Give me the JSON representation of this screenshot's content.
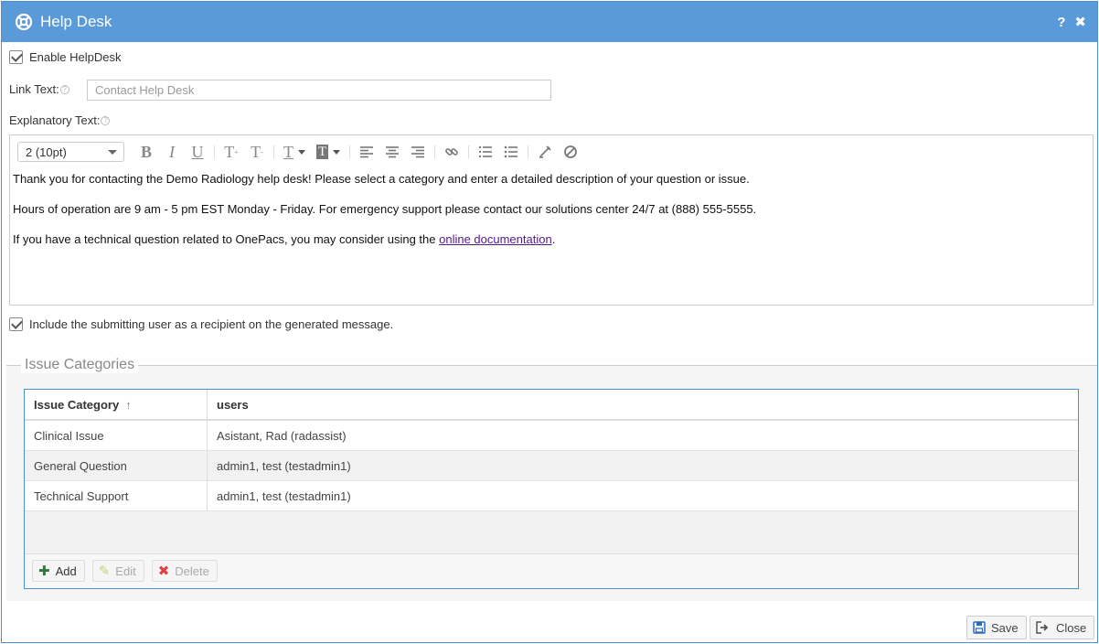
{
  "window": {
    "title": "Help Desk",
    "help_label": "?",
    "close_label": "✖"
  },
  "form": {
    "enable_label": "Enable HelpDesk",
    "enable_checked": true,
    "link_text_label": "Link Text:",
    "link_text_placeholder": "Contact Help Desk",
    "explanatory_label": "Explanatory Text:",
    "include_user_label": "Include the submitting user as a recipient on the generated message.",
    "include_user_checked": true
  },
  "editor": {
    "font_size_value": "2 (10pt)",
    "paragraph1": "Thank you for contacting the Demo Radiology help desk!  Please select a category and enter a detailed description of your question or issue.",
    "paragraph2": "Hours of operation are 9 am - 5 pm EST Monday - Friday.  For emergency support please contact our solutions center 24/7 at (888) 555-5555.",
    "paragraph3_prefix": "If you have a technical question related to OnePacs, you may consider using the ",
    "paragraph3_link": "online documentation",
    "paragraph3_suffix": "."
  },
  "categories": {
    "legend": "Issue Categories",
    "columns": [
      "Issue Category",
      "users"
    ],
    "sort_indicator": "↑",
    "rows": [
      [
        "Clinical Issue",
        "Asistant, Rad (radassist)"
      ],
      [
        "General Question",
        "admin1, test (testadmin1)"
      ],
      [
        "Technical Support",
        "admin1, test (testadmin1)"
      ]
    ],
    "add_label": "Add",
    "edit_label": "Edit",
    "delete_label": "Delete"
  },
  "footer": {
    "save_label": "Save",
    "close_label": "Close"
  },
  "colors": {
    "titlebar": "#5b9ad9",
    "accent_border": "#4a8fd1",
    "link": "#551a8b",
    "add_icon": "#2a7a3a",
    "delete_icon": "#e04040"
  }
}
